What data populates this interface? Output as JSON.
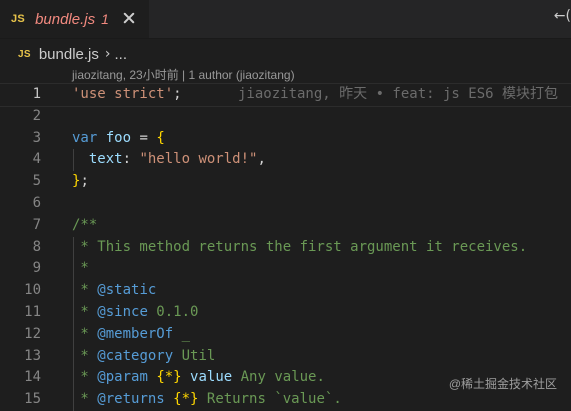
{
  "tab": {
    "icon": "JS",
    "name": "bundle.js",
    "problem_count": "1"
  },
  "editor_action": "←(",
  "breadcrumb": {
    "icon": "JS",
    "file": "bundle.js",
    "separator": "›",
    "more": "..."
  },
  "codelens": "jiaozitang, 23小时前 | 1 author (jiaozitang)",
  "lines": [
    {
      "n": "1",
      "current": true,
      "tokens": [
        {
          "t": "'use strict'",
          "c": "str"
        },
        {
          "t": ";",
          "c": "punc"
        }
      ],
      "blame": "jiaozitang, 昨天 • feat: js ES6 模块打包"
    },
    {
      "n": "2",
      "tokens": []
    },
    {
      "n": "3",
      "tokens": [
        {
          "t": "var ",
          "c": "kw"
        },
        {
          "t": "foo",
          "c": "var"
        },
        {
          "t": " = ",
          "c": "punc"
        },
        {
          "t": "{",
          "c": "brace"
        }
      ]
    },
    {
      "n": "4",
      "tokens": [
        {
          "t": "  text",
          "c": "prop"
        },
        {
          "t": ": ",
          "c": "punc"
        },
        {
          "t": "\"hello world!\"",
          "c": "str"
        },
        {
          "t": ",",
          "c": "punc"
        }
      ]
    },
    {
      "n": "5",
      "tokens": [
        {
          "t": "}",
          "c": "brace"
        },
        {
          "t": ";",
          "c": "punc"
        }
      ]
    },
    {
      "n": "6",
      "tokens": []
    },
    {
      "n": "7",
      "tokens": [
        {
          "t": "/**",
          "c": "cmt"
        }
      ]
    },
    {
      "n": "8",
      "tokens": [
        {
          "t": " * This method returns the first argument it receives.",
          "c": "cmt"
        }
      ]
    },
    {
      "n": "9",
      "tokens": [
        {
          "t": " *",
          "c": "cmt"
        }
      ]
    },
    {
      "n": "10",
      "tokens": [
        {
          "t": " * ",
          "c": "cmt"
        },
        {
          "t": "@static",
          "c": "tag"
        }
      ]
    },
    {
      "n": "11",
      "tokens": [
        {
          "t": " * ",
          "c": "cmt"
        },
        {
          "t": "@since",
          "c": "tag"
        },
        {
          "t": " 0.1.0",
          "c": "cmt"
        }
      ]
    },
    {
      "n": "12",
      "tokens": [
        {
          "t": " * ",
          "c": "cmt"
        },
        {
          "t": "@memberOf",
          "c": "tag"
        },
        {
          "t": " _",
          "c": "cmt"
        }
      ]
    },
    {
      "n": "13",
      "tokens": [
        {
          "t": " * ",
          "c": "cmt"
        },
        {
          "t": "@category",
          "c": "tag"
        },
        {
          "t": " Util",
          "c": "cmt"
        }
      ]
    },
    {
      "n": "14",
      "tokens": [
        {
          "t": " * ",
          "c": "cmt"
        },
        {
          "t": "@param",
          "c": "tag"
        },
        {
          "t": " ",
          "c": "cmt"
        },
        {
          "t": "{*}",
          "c": "cbrace"
        },
        {
          "t": " value",
          "c": "cvar"
        },
        {
          "t": " Any value.",
          "c": "cmt"
        }
      ]
    },
    {
      "n": "15",
      "tokens": [
        {
          "t": " * ",
          "c": "cmt"
        },
        {
          "t": "@returns",
          "c": "tag"
        },
        {
          "t": " ",
          "c": "cmt"
        },
        {
          "t": "{*}",
          "c": "cbrace"
        },
        {
          "t": " Returns `value`.",
          "c": "cmt"
        }
      ]
    }
  ],
  "watermark": "@稀土掘金技术社区"
}
